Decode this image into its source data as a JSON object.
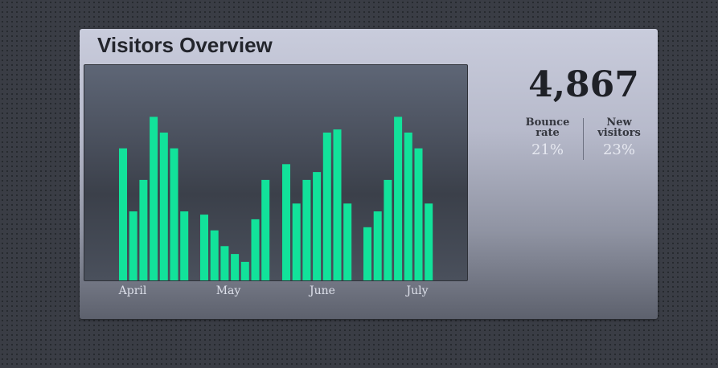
{
  "title": "Visitors Overview",
  "summary": {
    "total": "4,867",
    "bounce_rate_label_1": "Bounce",
    "bounce_rate_label_2": "rate",
    "bounce_rate_value": "21%",
    "new_visitors_label_1": "New",
    "new_visitors_label_2": "visitors",
    "new_visitors_value": "23%"
  },
  "colors": {
    "bar": "#12e29a"
  },
  "chart_data": {
    "type": "bar",
    "title": "",
    "xlabel": "",
    "ylabel": "",
    "ylim": [
      0,
      110
    ],
    "grid": false,
    "legend": "none",
    "months": [
      "April",
      "May",
      "June",
      "July"
    ],
    "groups": [
      {
        "month": "April",
        "values": [
          70,
          30,
          50,
          90,
          80,
          70,
          30
        ]
      },
      {
        "month": "May",
        "values": [
          28,
          18,
          8,
          3,
          -2,
          25,
          50
        ]
      },
      {
        "month": "June",
        "values": [
          60,
          35,
          50,
          55,
          80,
          82,
          35
        ]
      },
      {
        "month": "July",
        "values": [
          20,
          30,
          50,
          90,
          80,
          70,
          35
        ]
      }
    ]
  }
}
